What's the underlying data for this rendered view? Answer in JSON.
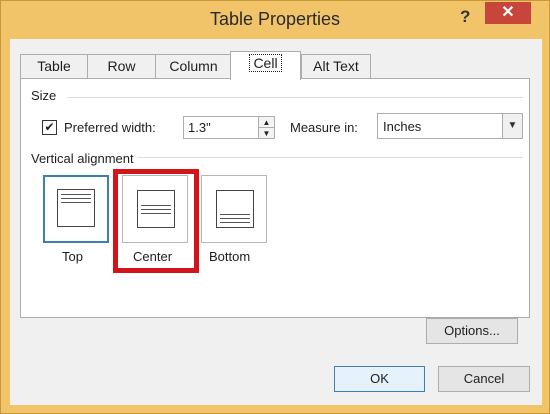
{
  "window": {
    "title": "Table Properties",
    "help_label": "?",
    "close_label": "✕"
  },
  "tabs": [
    {
      "label": "Table",
      "active": false
    },
    {
      "label": "Row",
      "active": false
    },
    {
      "label": "Column",
      "active": false
    },
    {
      "label": "Cell",
      "active": true
    },
    {
      "label": "Alt Text",
      "active": false
    }
  ],
  "size": {
    "section_label": "Size",
    "preferred_width_checked": true,
    "preferred_width_label": "Preferred width:",
    "width_value": "1.3\"",
    "measure_in_label": "Measure in:",
    "measure_in_value": "Inches"
  },
  "vertical_alignment": {
    "section_label": "Vertical alignment",
    "options": [
      {
        "label": "Top",
        "selected": true
      },
      {
        "label": "Center",
        "selected": false,
        "highlighted": true
      },
      {
        "label": "Bottom",
        "selected": false
      }
    ]
  },
  "buttons": {
    "options": "Options...",
    "ok": "OK",
    "cancel": "Cancel"
  },
  "colors": {
    "frame": "#f2c46a",
    "close": "#c7463c",
    "highlight": "#d3141b",
    "selection": "#3c7fb1"
  }
}
